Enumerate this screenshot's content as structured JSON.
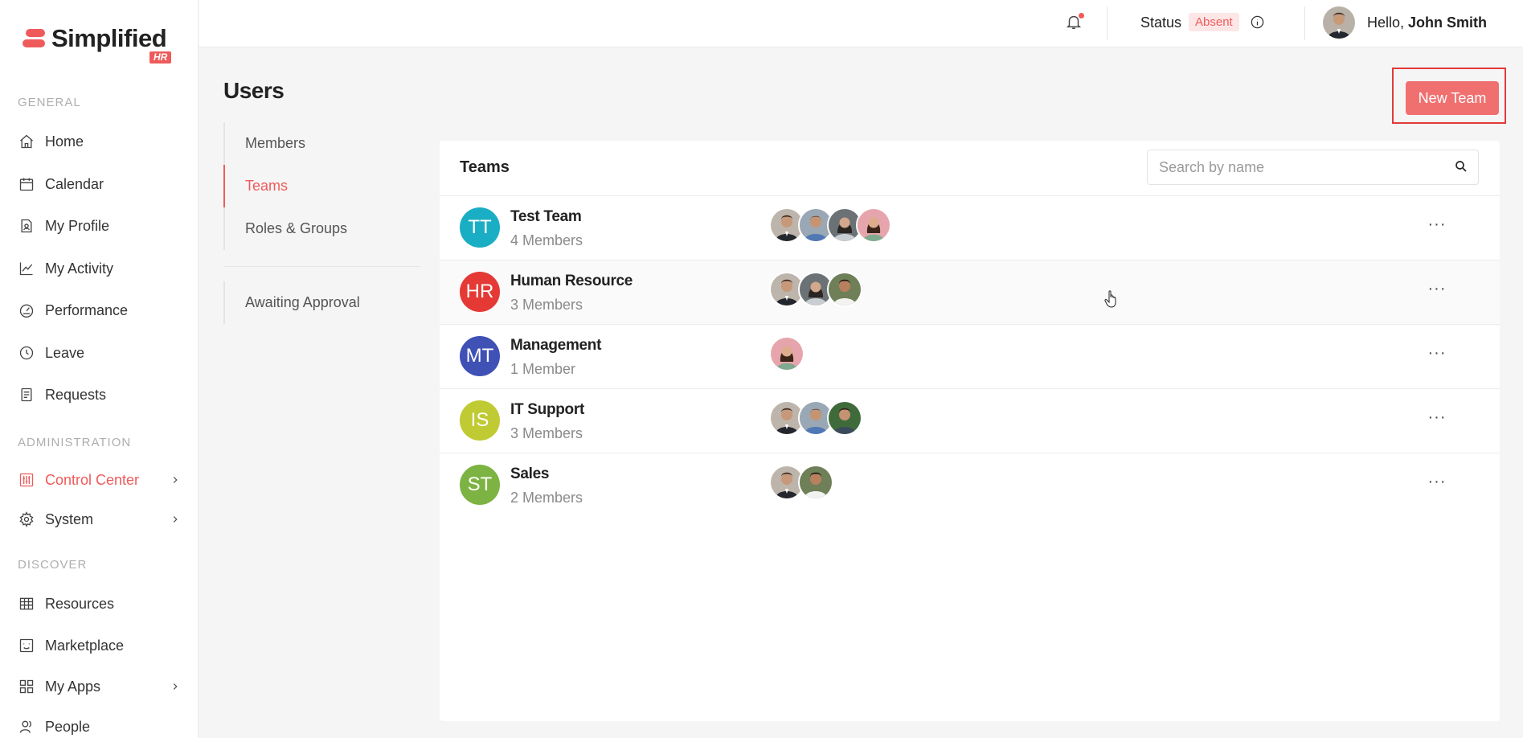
{
  "logo": {
    "text": "Simplified",
    "badge": "HR"
  },
  "sidebar": {
    "sections": {
      "general": "GENERAL",
      "administration": "ADMINISTRATION",
      "discover": "DISCOVER"
    },
    "general": [
      {
        "label": "Home",
        "icon": "home-icon"
      },
      {
        "label": "Calendar",
        "icon": "calendar-icon"
      },
      {
        "label": "My Profile",
        "icon": "profile-icon"
      },
      {
        "label": "My Activity",
        "icon": "activity-icon"
      },
      {
        "label": "Performance",
        "icon": "gauge-icon"
      },
      {
        "label": "Leave",
        "icon": "clock-icon"
      },
      {
        "label": "Requests",
        "icon": "document-icon"
      }
    ],
    "administration": [
      {
        "label": "Control Center",
        "icon": "sliders-icon",
        "active": true
      },
      {
        "label": "System",
        "icon": "gear-icon"
      }
    ],
    "discover": [
      {
        "label": "Resources",
        "icon": "table-icon"
      },
      {
        "label": "Marketplace",
        "icon": "marketplace-icon"
      },
      {
        "label": "My Apps",
        "icon": "apps-grid-icon"
      },
      {
        "label": "People",
        "icon": "people-icon"
      }
    ]
  },
  "topbar": {
    "status_label": "Status",
    "status_value": "Absent",
    "greeting": "Hello,",
    "user_name": "John Smith"
  },
  "page": {
    "title": "Users",
    "new_team_label": "New Team",
    "subnav": [
      "Members",
      "Teams",
      "Roles & Groups"
    ],
    "subnav_extra": "Awaiting Approval",
    "active_tab": "Teams"
  },
  "teams_panel": {
    "title": "Teams",
    "search_placeholder": "Search by name",
    "more_label": "···",
    "rows": [
      {
        "initials": "TT",
        "name": "Test Team",
        "count": "4 Members",
        "color": "#1aaec4",
        "members": [
          "man-suit",
          "man-blue",
          "woman-gray",
          "woman-pink"
        ]
      },
      {
        "initials": "HR",
        "name": "Human Resource",
        "count": "3 Members",
        "color": "#e53935",
        "members": [
          "man-suit",
          "woman-gray",
          "man-white"
        ]
      },
      {
        "initials": "MT",
        "name": "Management",
        "count": "1 Member",
        "color": "#3f51b5",
        "members": [
          "woman-pink"
        ]
      },
      {
        "initials": "IS",
        "name": "IT Support",
        "count": "3 Members",
        "color": "#c0ca33",
        "members": [
          "man-suit",
          "man-blue",
          "man-green"
        ]
      },
      {
        "initials": "ST",
        "name": "Sales",
        "count": "2 Members",
        "color": "#7cb342",
        "members": [
          "man-suit",
          "man-white"
        ]
      }
    ]
  },
  "colors": {
    "accent": "#ef5b5b",
    "button": "#f07070"
  }
}
